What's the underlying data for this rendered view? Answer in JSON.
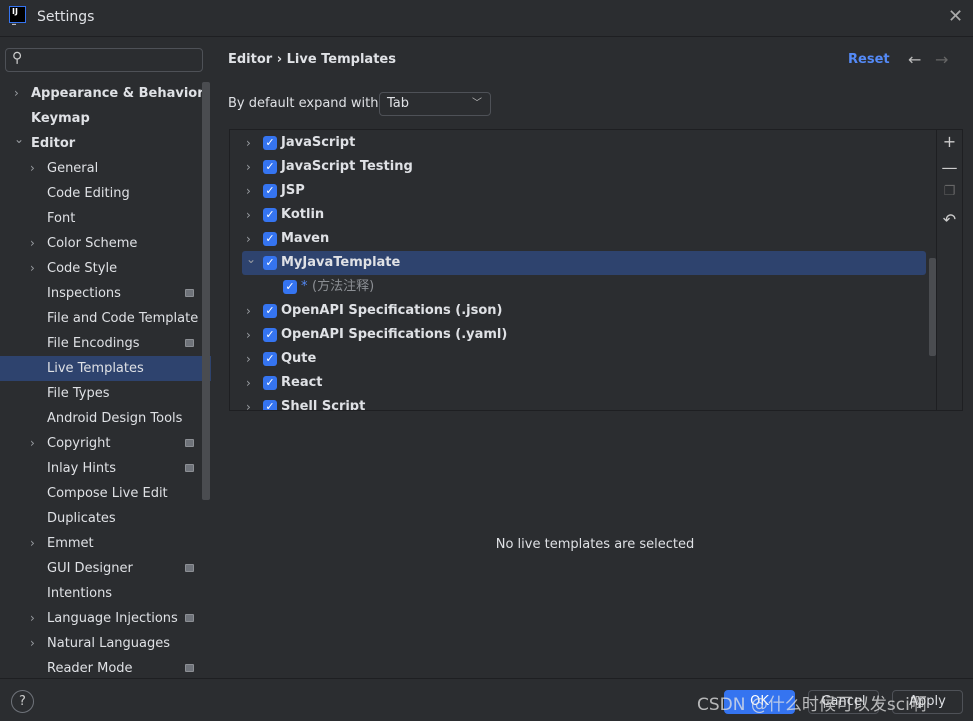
{
  "window": {
    "title": "Settings",
    "logo": "IJ",
    "close_icon": "close-icon"
  },
  "search": {
    "placeholder": ""
  },
  "sidebar": {
    "items": [
      {
        "label": "Appearance & Behavior",
        "level": 0,
        "chevron": "right",
        "bold": true
      },
      {
        "label": "Keymap",
        "level": 0,
        "bold": true
      },
      {
        "label": "Editor",
        "level": 0,
        "chevron": "down",
        "bold": true
      },
      {
        "label": "General",
        "level": 1,
        "chevron": "right"
      },
      {
        "label": "Code Editing",
        "level": 1
      },
      {
        "label": "Font",
        "level": 1
      },
      {
        "label": "Color Scheme",
        "level": 1,
        "chevron": "right"
      },
      {
        "label": "Code Style",
        "level": 1,
        "chevron": "right"
      },
      {
        "label": "Inspections",
        "level": 1,
        "pin": true
      },
      {
        "label": "File and Code Template",
        "level": 1
      },
      {
        "label": "File Encodings",
        "level": 1,
        "pin": true
      },
      {
        "label": "Live Templates",
        "level": 1,
        "selected": true
      },
      {
        "label": "File Types",
        "level": 1
      },
      {
        "label": "Android Design Tools",
        "level": 1
      },
      {
        "label": "Copyright",
        "level": 1,
        "chevron": "right",
        "pin": true
      },
      {
        "label": "Inlay Hints",
        "level": 1,
        "pin": true
      },
      {
        "label": "Compose Live Edit",
        "level": 1
      },
      {
        "label": "Duplicates",
        "level": 1
      },
      {
        "label": "Emmet",
        "level": 1,
        "chevron": "right"
      },
      {
        "label": "GUI Designer",
        "level": 1,
        "pin": true
      },
      {
        "label": "Intentions",
        "level": 1
      },
      {
        "label": "Language Injections",
        "level": 1,
        "chevron": "right",
        "pin": true
      },
      {
        "label": "Natural Languages",
        "level": 1,
        "chevron": "right"
      },
      {
        "label": "Reader Mode",
        "level": 1,
        "pin": true
      }
    ]
  },
  "header": {
    "breadcrumb": "Editor  ›  Live Templates",
    "reset": "Reset"
  },
  "expand": {
    "label": "By default expand with",
    "value": "Tab"
  },
  "tree": {
    "items": [
      {
        "label": "JavaScript",
        "checked": true
      },
      {
        "label": "JavaScript Testing",
        "checked": true
      },
      {
        "label": "JSP",
        "checked": true
      },
      {
        "label": "Kotlin",
        "checked": true
      },
      {
        "label": "Maven",
        "checked": true
      },
      {
        "label": "MyJavaTemplate",
        "checked": true,
        "expanded": true,
        "selected": true
      },
      {
        "label": "*",
        "desc": "(方法注释)",
        "checked": true,
        "child": true
      },
      {
        "label": "OpenAPI Specifications (.json)",
        "checked": true
      },
      {
        "label": "OpenAPI Specifications (.yaml)",
        "checked": true
      },
      {
        "label": "Qute",
        "checked": true
      },
      {
        "label": "React",
        "checked": true
      },
      {
        "label": "Shell Script",
        "checked": true
      }
    ]
  },
  "empty_message": "No live templates are selected",
  "buttons": {
    "ok": "OK",
    "cancel": "Cancel",
    "apply": "Apply",
    "help": "?"
  },
  "watermark": "CSDN @什么时候可以发sci啊",
  "colors": {
    "accent": "#3574f0",
    "selection": "#2e436e",
    "link": "#548af7",
    "background": "#2b2d30"
  }
}
